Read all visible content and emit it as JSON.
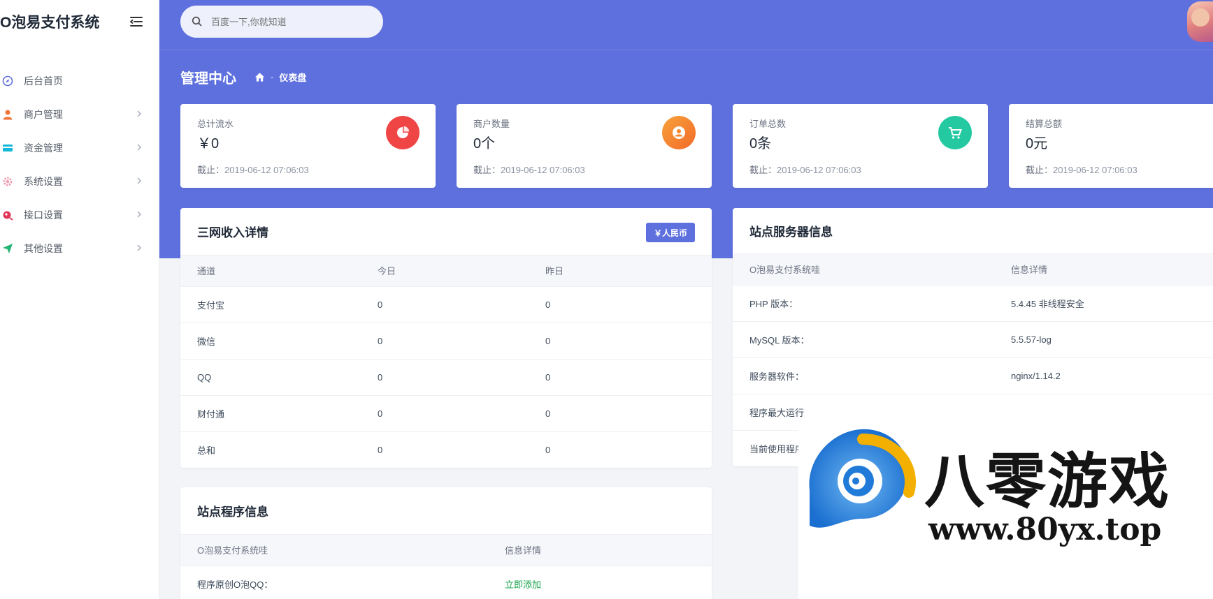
{
  "app": {
    "brand": "O泡易支付系统"
  },
  "sidebar": {
    "items": [
      {
        "label": "后台首页",
        "icon": "compass-icon",
        "color": "#5e70dd",
        "has_arrow": false
      },
      {
        "label": "商户管理",
        "icon": "user-icon",
        "color": "#f0763c",
        "has_arrow": true
      },
      {
        "label": "资金管理",
        "icon": "card-icon",
        "color": "#13b9d8",
        "has_arrow": true
      },
      {
        "label": "系统设置",
        "icon": "gear-icon",
        "color": "#f29bb0",
        "has_arrow": true
      },
      {
        "label": "接口设置",
        "icon": "plug-icon",
        "color": "#e2365a",
        "has_arrow": true
      },
      {
        "label": "其他设置",
        "icon": "paper-plane-icon",
        "color": "#22b573",
        "has_arrow": true
      }
    ]
  },
  "search": {
    "placeholder": "百度一下,你就知道"
  },
  "header": {
    "title": "管理中心",
    "breadcrumb_home": "home-icon",
    "breadcrumb_sep": "-",
    "breadcrumb_current": "仪表盘"
  },
  "stats": [
    {
      "label": "总计流水",
      "value": "￥0",
      "date_key": "截止：",
      "date": "2019-06-12 07:06:03",
      "icon": "pie-chart-icon",
      "color": "#f04545"
    },
    {
      "label": "商户数量",
      "value": "0个",
      "date_key": "截止：",
      "date": "2019-06-12 07:06:03",
      "icon": "user-circle-icon",
      "color": "#f7852a"
    },
    {
      "label": "订单总数",
      "value": "0条",
      "date_key": "截止：",
      "date": "2019-06-12 07:06:03",
      "icon": "cart-icon",
      "color": "#24c9a1"
    },
    {
      "label": "结算总额",
      "value": "0元",
      "date_key": "截止：",
      "date": "2019-06-12 07:06:03",
      "icon": "",
      "color": ""
    }
  ],
  "income": {
    "title": "三网收入详情",
    "button": "￥人民币",
    "headers": [
      "通道",
      "今日",
      "昨日"
    ],
    "rows": [
      [
        "支付宝",
        "0",
        "0"
      ],
      [
        "微信",
        "0",
        "0"
      ],
      [
        "QQ",
        "0",
        "0"
      ],
      [
        "财付通",
        "0",
        "0"
      ],
      [
        "总和",
        "0",
        "0"
      ]
    ]
  },
  "program": {
    "title": "站点程序信息",
    "headers": [
      "O泡易支付系统哇",
      "信息详情"
    ],
    "rows": [
      [
        "程序原创O泡QQ：",
        "立即添加"
      ]
    ]
  },
  "server": {
    "title": "站点服务器信息",
    "headers": [
      "O泡易支付系统哇",
      "信息详情"
    ],
    "rows": [
      [
        "PHP 版本：",
        "5.4.45 非线程安全"
      ],
      [
        "MySQL 版本：",
        "5.5.57-log"
      ],
      [
        "服务器软件：",
        "nginx/1.14.2"
      ],
      [
        "程序最大运行",
        ""
      ],
      [
        "当前使用程序",
        ""
      ]
    ]
  },
  "watermark": {
    "text": "八零游戏",
    "url": "www.80yx.top"
  }
}
